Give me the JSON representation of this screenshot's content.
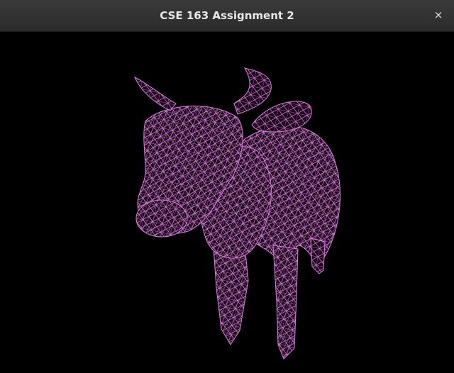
{
  "window": {
    "title": "CSE 163 Assignment 2",
    "close_glyph": "×"
  },
  "viewport": {
    "background": "#000000",
    "model": {
      "name": "cow",
      "render_mode": "wireframe",
      "wire_color": "#e07ae0"
    }
  },
  "icons": {
    "close": "close-icon"
  }
}
